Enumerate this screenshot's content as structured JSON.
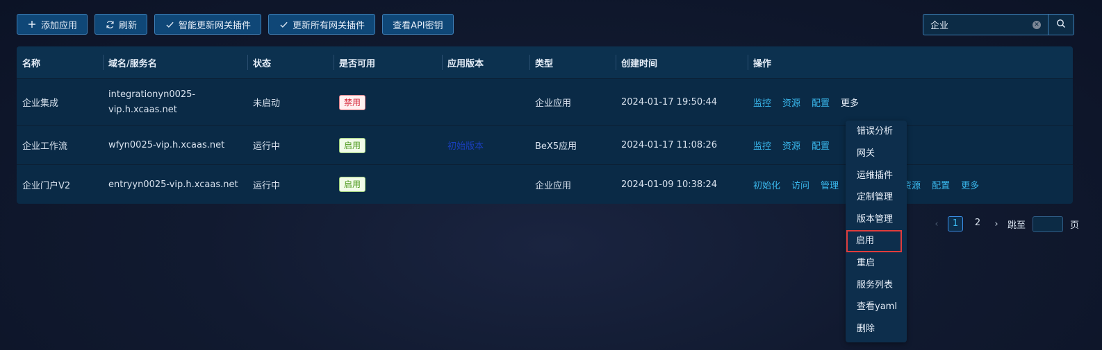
{
  "toolbar": {
    "add_label": "添加应用",
    "refresh_label": "刷新",
    "smart_update_label": "智能更新网关插件",
    "update_all_label": "更新所有网关插件",
    "api_key_label": "查看API密钥"
  },
  "search": {
    "value": "企业"
  },
  "table": {
    "headers": [
      "名称",
      "域名/服务名",
      "状态",
      "是否可用",
      "应用版本",
      "类型",
      "创建时间",
      "操作"
    ],
    "rows": [
      {
        "name": "企业集成",
        "domain_line1": "integrationyn0025-",
        "domain_line2": "vip.h.xcaas.net",
        "status": "未启动",
        "availability": "禁用",
        "version": "",
        "type": "企业应用",
        "created": "2024-01-17 19:50:44",
        "ops": [
          "监控",
          "资源",
          "配置",
          "更多"
        ]
      },
      {
        "name": "企业工作流",
        "domain": "wfyn0025-vip.h.xcaas.net",
        "status": "运行中",
        "availability": "启用",
        "version": "初始版本",
        "type": "BeX5应用",
        "created": "2024-01-17 11:08:26",
        "ops": [
          "监控",
          "资源",
          "配置"
        ]
      },
      {
        "name": "企业门户V2",
        "domain": "entryyn0025-vip.h.xcaas.net",
        "status": "运行中",
        "availability": "启用",
        "version": "",
        "type": "企业应用",
        "created": "2024-01-09 10:38:24",
        "ops": [
          "初始化",
          "访问",
          "管理",
          "资源",
          "配置",
          "更多"
        ]
      }
    ]
  },
  "pagination": {
    "pages": [
      "1",
      "2"
    ],
    "active": "1",
    "jump_label": "跳至",
    "page_suffix": "页"
  },
  "dropdown": {
    "items": [
      "错误分析",
      "网关",
      "运维插件",
      "定制管理",
      "版本管理",
      "启用",
      "重启",
      "服务列表",
      "查看yaml",
      "删除"
    ],
    "highlighted": "启用"
  },
  "colors": {
    "background": "#111a30",
    "table": "#0a2a46",
    "button": "#0f4777",
    "link": "#3ab7ec",
    "highlight_box": "#e03c3c"
  }
}
